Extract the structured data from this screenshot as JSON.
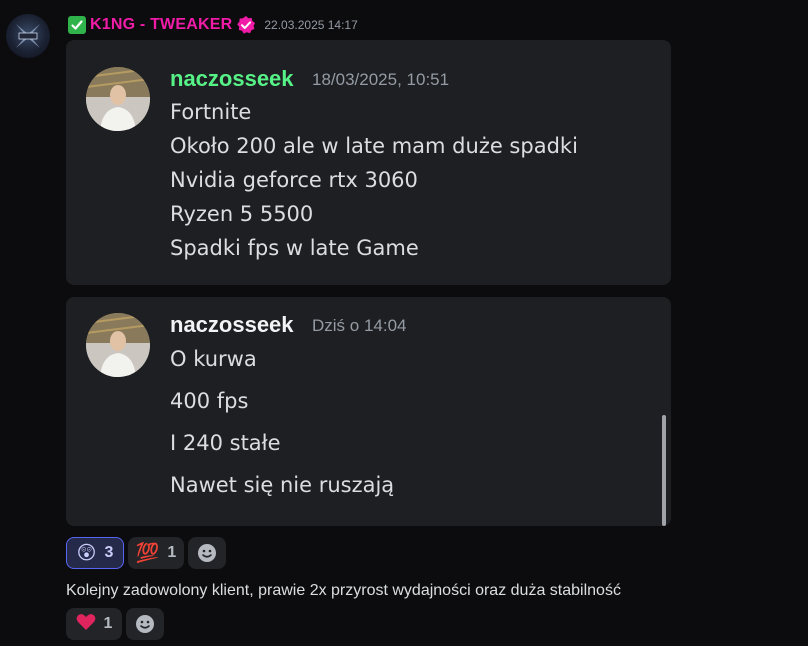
{
  "message": {
    "author": "K1NG - TWEAKER",
    "timestamp": "22.03.2025 14:17",
    "caption": "Kolejny zadowolony klient, prawie 2x przyrost wydajności oraz duża stabilność"
  },
  "quotes": [
    {
      "author": "naczosseek",
      "author_color": "#57f287",
      "date": "18/03/2025, 10:51",
      "lines": [
        "Fortnite",
        "Około 200  ale w late mam duże spadki",
        "Nvidia geforce rtx 3060",
        "Ryzen 5 5500",
        "Spadki fps w late Game"
      ]
    },
    {
      "author": "naczosseek",
      "author_color": "#f2f3f5",
      "date": "Dziś o 14:04",
      "lines": [
        "O kurwa",
        "400 fps",
        "I 240 stałe",
        "Nawet się nie ruszają"
      ]
    }
  ],
  "reactions_image": [
    {
      "emoji": "😲",
      "icon": "astonished-face-icon",
      "count": "3",
      "active": true
    },
    {
      "emoji": "💯",
      "icon": "hundred-points-icon",
      "count": "1",
      "active": false
    }
  ],
  "reactions_caption": [
    {
      "emoji": "❤️",
      "icon": "red-heart-icon",
      "count": "1",
      "active": false
    }
  ],
  "colors": {
    "background": "#0c0c0e",
    "embed": "#1e1f22",
    "username": "#f01ca8",
    "accent": "#5865f2"
  }
}
